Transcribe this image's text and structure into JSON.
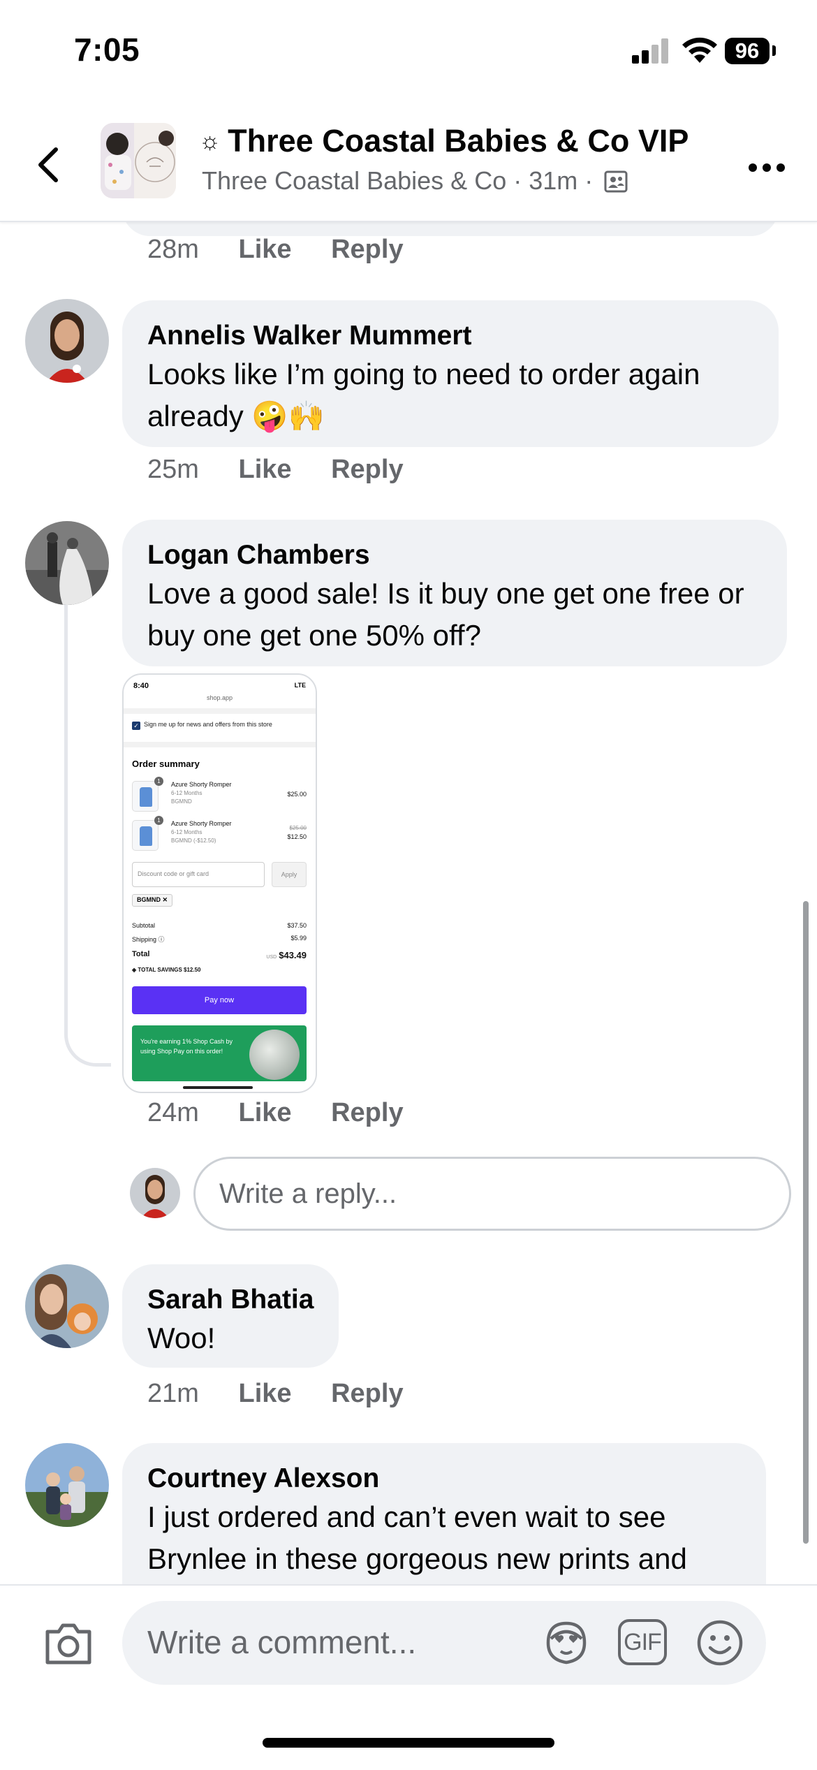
{
  "status_bar": {
    "time": "7:05",
    "battery": "96"
  },
  "header": {
    "group_name": "Three Coastal Babies & Co VIP",
    "sun_symbol": "☼",
    "page_name": "Three Coastal Babies & Co",
    "separator": "·",
    "age": "31m"
  },
  "comments": [
    {
      "author": "",
      "text": "",
      "time": "28m",
      "like_label": "Like",
      "reply_label": "Reply"
    },
    {
      "author": "Annelis Walker Mummert",
      "text": "Looks like I’m going to need to order again already 🤪🙌",
      "time": "25m",
      "like_label": "Like",
      "reply_label": "Reply"
    },
    {
      "author": "Logan Chambers",
      "text": "Love a good sale! Is it buy one get one free or buy one get one 50% off?",
      "time": "24m",
      "like_label": "Like",
      "reply_label": "Reply"
    },
    {
      "author": "Sarah Bhatia",
      "text": "Woo!",
      "time": "21m",
      "like_label": "Like",
      "reply_label": "Reply"
    },
    {
      "author": "Courtney Alexson",
      "text": "I just ordered and can’t even wait to see Brynlee in these gorgeous new prints and",
      "time": "",
      "like_label": "",
      "reply_label": ""
    }
  ],
  "attachment": {
    "status_time": "8:40",
    "status_right": "LTE",
    "url": "shop.app",
    "newsletter_label": "Sign me up for news and offers from this store",
    "heading": "Order summary",
    "items": [
      {
        "name": "Azure Shorty Romper",
        "size": "6-12 Months",
        "code": "BGMND",
        "qty": "1",
        "price": "$25.00",
        "original_price": ""
      },
      {
        "name": "Azure Shorty Romper",
        "size": "6-12 Months",
        "code": "BGMND (-$12.50)",
        "qty": "1",
        "price": "$12.50",
        "original_price": "$25.00"
      }
    ],
    "discount_placeholder": "Discount code or gift card",
    "apply_label": "Apply",
    "applied_code": "BGMND",
    "subtotal_label": "Subtotal",
    "subtotal": "$37.50",
    "shipping_label": "Shipping",
    "shipping": "$5.99",
    "total_label": "Total",
    "currency": "USD",
    "total": "$43.49",
    "savings_label": "TOTAL SAVINGS",
    "savings": "$12.50",
    "pay_label": "Pay now",
    "shop_cash_text": "You're earning 1% Shop Cash by using Shop Pay on this order!"
  },
  "reply_input": {
    "placeholder": "Write a reply..."
  },
  "composer": {
    "placeholder": "Write a comment...",
    "gif_label": "GIF"
  },
  "icons": {
    "back": "chevron-left-icon",
    "more": "more-horizontal-icon",
    "audience": "members-icon",
    "camera": "camera-icon",
    "sticker": "sticker-icon",
    "emoji": "emoji-icon"
  },
  "colors": {
    "bubble": "#f0f2f5",
    "secondary_text": "#65676b",
    "pay_button": "#5a31f4",
    "shop_cash": "#1e9e5b"
  }
}
